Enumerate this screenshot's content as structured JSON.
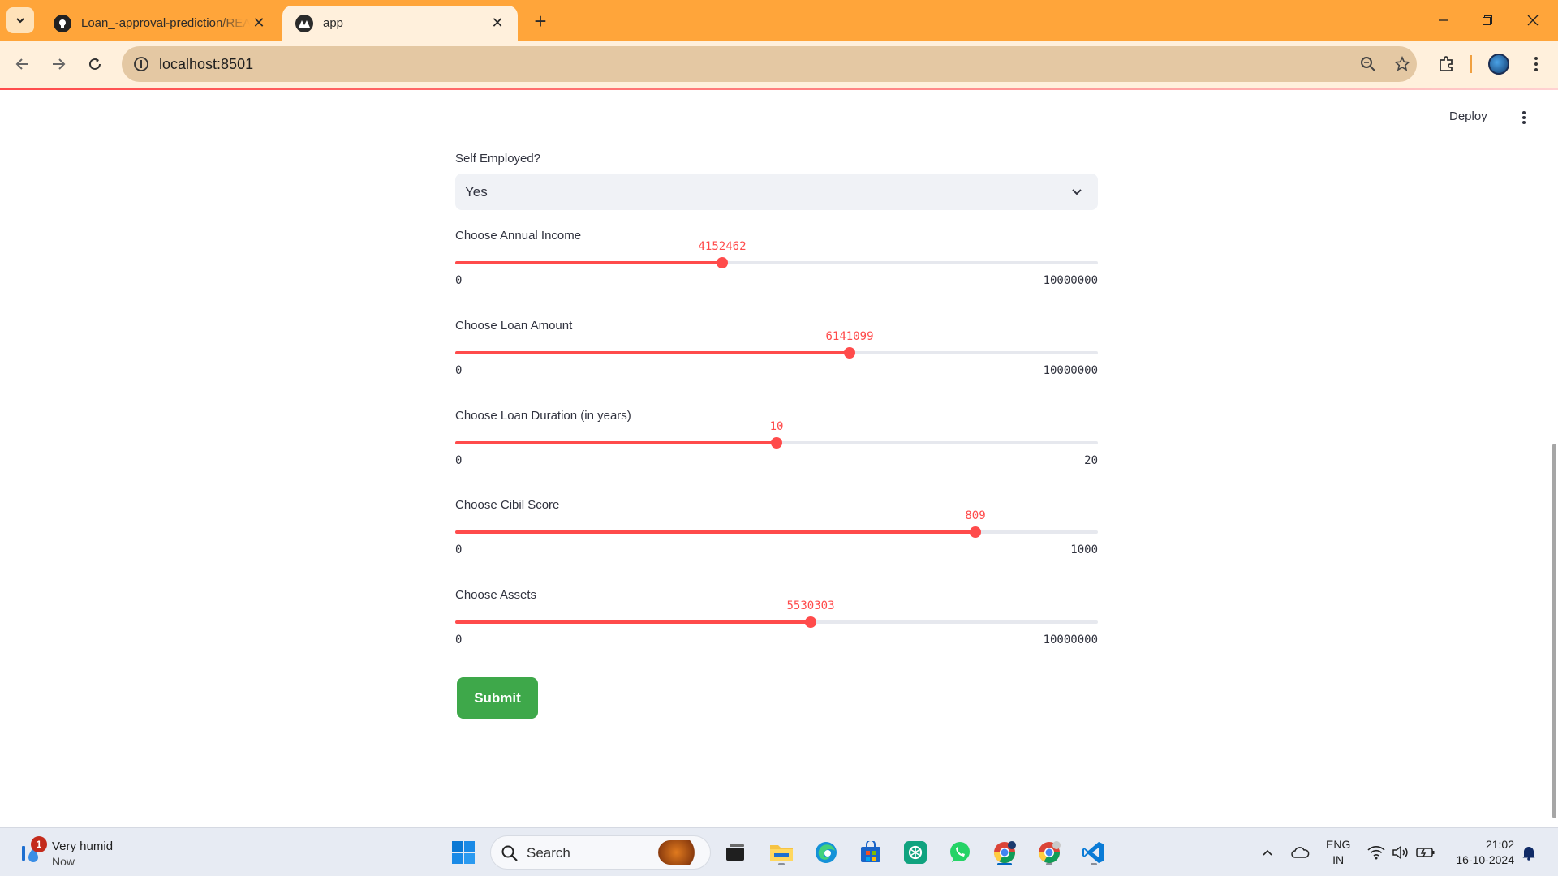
{
  "browser": {
    "tabs": [
      {
        "title": "Loan_-approval-prediction/README.md",
        "active": false,
        "favicon": "github-icon"
      },
      {
        "title": "app",
        "active": true,
        "favicon": "streamlit-icon"
      }
    ],
    "url": "localhost:8501"
  },
  "app": {
    "deploy_label": "Deploy",
    "self_employed": {
      "label": "Self Employed?",
      "value": "Yes"
    },
    "sliders": [
      {
        "label": "Choose Annual Income",
        "value": "4152462",
        "min": "0",
        "max": "10000000",
        "fraction": 0.4152462
      },
      {
        "label": "Choose Loan Amount",
        "value": "6141099",
        "min": "0",
        "max": "10000000",
        "fraction": 0.6141099
      },
      {
        "label": "Choose Loan Duration (in years)",
        "value": "10",
        "min": "0",
        "max": "20",
        "fraction": 0.5
      },
      {
        "label": "Choose Cibil Score",
        "value": "809",
        "min": "0",
        "max": "1000",
        "fraction": 0.809
      },
      {
        "label": "Choose Assets",
        "value": "5530303",
        "min": "0",
        "max": "10000000",
        "fraction": 0.5530303
      }
    ],
    "submit_label": "Submit",
    "accent_color": "#ff4b4b",
    "submit_color": "#3ea84a"
  },
  "taskbar": {
    "weather": {
      "badge": "1",
      "condition": "Very humid",
      "time": "Now"
    },
    "search_placeholder": "Search",
    "language": {
      "line1": "ENG",
      "line2": "IN"
    },
    "clock": {
      "time": "21:02",
      "date": "16-10-2024"
    }
  }
}
